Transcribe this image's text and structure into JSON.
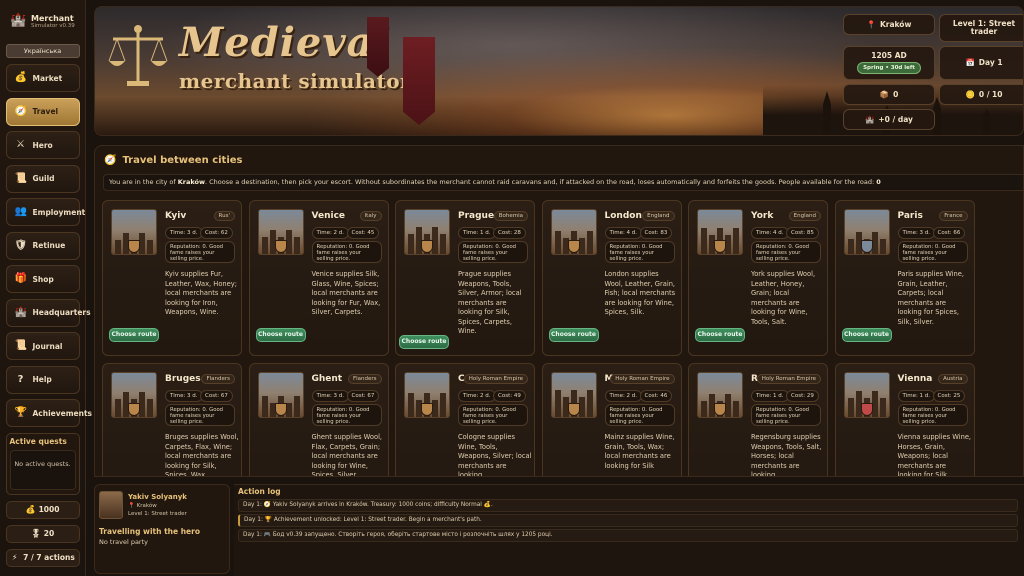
{
  "brand": {
    "title": "Merchant",
    "subtitle": "Simulator v0.39"
  },
  "language_button": "Українська",
  "nav": [
    {
      "label": "Market",
      "icon": "money-bag-icon",
      "glyph": "💰"
    },
    {
      "label": "Travel",
      "icon": "compass-icon",
      "glyph": "🧭"
    },
    {
      "label": "Hero",
      "icon": "hero-icon",
      "glyph": "⚔"
    },
    {
      "label": "Guild",
      "icon": "scroll-icon",
      "glyph": "📜"
    },
    {
      "label": "Employment",
      "icon": "people-icon",
      "glyph": "👥"
    },
    {
      "label": "Retinue",
      "icon": "shield-icon",
      "glyph": "🛡"
    },
    {
      "label": "Shop",
      "icon": "gift-icon",
      "glyph": "🎁"
    },
    {
      "label": "Headquarters",
      "icon": "castle-icon",
      "glyph": "🏰"
    },
    {
      "label": "Journal",
      "icon": "journal-icon",
      "glyph": "📜"
    },
    {
      "label": "Help",
      "icon": "question-icon",
      "glyph": "?"
    },
    {
      "label": "Achievements",
      "icon": "trophy-icon",
      "glyph": "🏆"
    }
  ],
  "active_quests": {
    "title": "Active quests",
    "empty": "No active quests."
  },
  "sidebar_stats": {
    "coins": "1000",
    "fame": "20",
    "actions": "7 / 7 actions"
  },
  "header": {
    "title_main": "Medieval",
    "title_sub": "merchant simulator",
    "city": "Kraków",
    "level": "Level 1: Street trader",
    "year": "1205 AD",
    "season": "Spring • 30d left",
    "day": "Day 1",
    "stat_a": "0",
    "stat_b": "0 / 10",
    "per_day": "+0 / day"
  },
  "travel": {
    "title": "Travel between cities",
    "info_prefix": "You are in the city of ",
    "info_city": "Kraków",
    "info_suffix": ". Choose a destination, then pick your escort. Without subordinates the merchant cannot raid caravans and, if attacked on the road, loses automatically and forfeits the goods. People available for the road: ",
    "info_count": "0",
    "route_label": "Choose route",
    "cards": [
      {
        "name": "Kyiv",
        "region": "Rus'",
        "time": "Time: 3 d.",
        "cost": "Cost: 62",
        "rep": "Reputation: 0. Good fame raises your selling price.",
        "desc": "Kyiv supplies Fur, Leather, Wax, Honey; local merchants are looking for Iron, Weapons, Wine."
      },
      {
        "name": "Venice",
        "region": "Italy",
        "time": "Time: 2 d.",
        "cost": "Cost: 45",
        "rep": "Reputation: 0. Good fame raises your selling price.",
        "desc": "Venice supplies Silk, Glass, Wine, Spices; local merchants are looking for Fur, Wax, Silver, Carpets."
      },
      {
        "name": "Prague",
        "region": "Bohemia",
        "time": "Time: 1 d.",
        "cost": "Cost: 28",
        "rep": "Reputation: 0. Good fame raises your selling price.",
        "desc": "Prague supplies Weapons, Tools, Silver, Armor; local merchants are looking for Silk, Spices, Carpets, Wine."
      },
      {
        "name": "London",
        "region": "England",
        "time": "Time: 4 d.",
        "cost": "Cost: 83",
        "rep": "Reputation: 0. Good fame raises your selling price.",
        "desc": "London supplies Wool, Leather, Grain, Fish; local merchants are looking for Wine, Spices, Silk."
      },
      {
        "name": "York",
        "region": "England",
        "time": "Time: 4 d.",
        "cost": "Cost: 85",
        "rep": "Reputation: 0. Good fame raises your selling price.",
        "desc": "York supplies Wool, Leather, Honey, Grain; local merchants are looking for Wine, Tools, Salt."
      },
      {
        "name": "Paris",
        "region": "France",
        "time": "Time: 3 d.",
        "cost": "Cost: 66",
        "rep": "Reputation: 0. Good fame raises your selling price.",
        "desc": "Paris supplies Wine, Grain, Leather, Carpets; local merchants are looking for Spices, Silk, Silver."
      },
      {
        "name": "Bruges",
        "region": "Flanders",
        "time": "Time: 3 d.",
        "cost": "Cost: 67",
        "rep": "Reputation: 0. Good fame raises your selling price.",
        "desc": "Bruges supplies Wool, Carpets, Flax, Wine; local merchants are looking for Silk, Spices, Wax."
      },
      {
        "name": "Ghent",
        "region": "Flanders",
        "time": "Time: 3 d.",
        "cost": "Cost: 67",
        "rep": "Reputation: 0. Good fame raises your selling price.",
        "desc": "Ghent supplies Wool, Flax, Carpets, Grain; local merchants are looking for Wine, Spices, Silver."
      },
      {
        "name": "Cologne",
        "region": "Holy Roman Empire",
        "time": "Time: 2 d.",
        "cost": "Cost: 49",
        "rep": "Reputation: 0. Good fame raises your selling price.",
        "desc": "Cologne supplies Wine, Tools, Weapons, Silver; local merchants are looking"
      },
      {
        "name": "Mainz",
        "region": "Holy Roman Empire",
        "time": "Time: 2 d.",
        "cost": "Cost: 46",
        "rep": "Reputation: 0. Good fame raises your selling price.",
        "desc": "Mainz supplies Wine, Grain, Tools, Wax; local merchants are looking for Silk"
      },
      {
        "name": "Regensburg",
        "region": "Holy Roman Empire",
        "time": "Time: 1 d.",
        "cost": "Cost: 29",
        "rep": "Reputation: 0. Good fame raises your selling price.",
        "desc": "Regensburg supplies Weapons, Tools, Salt, Horses; local merchants are looking"
      },
      {
        "name": "Vienna",
        "region": "Austria",
        "time": "Time: 1 d.",
        "cost": "Cost: 25",
        "rep": "Reputation: 0. Good fame raises your selling price.",
        "desc": "Vienna supplies Wine, Horses, Grain, Weapons; local merchants are looking for Silk, Spices, Silver."
      }
    ]
  },
  "hero": {
    "name": "Yakiv Solyanyk",
    "city": "Kraków",
    "level": "Level 1: Street trader",
    "traveling_title": "Travelling with the hero",
    "party": "No travel party"
  },
  "log": {
    "title": "Action log",
    "entries": [
      "Day 1: 🧭 Yakiv Solyanyk arrives in Kraków. Treasury: 1000 coins; difficulty Normal 💰.",
      "Day 1: 🏆 Achievement unlocked: Level 1: Street trader. Begin a merchant's path.",
      "Day 1: 🎮 Бод v0.39 запущено. Створіть героя, оберіть стартове місто і розпочніть шлях у 1205 році."
    ]
  },
  "colors": {
    "accent": "#e8c27a",
    "active_nav": "#caa05a",
    "route_button": "#3f8f5e"
  }
}
